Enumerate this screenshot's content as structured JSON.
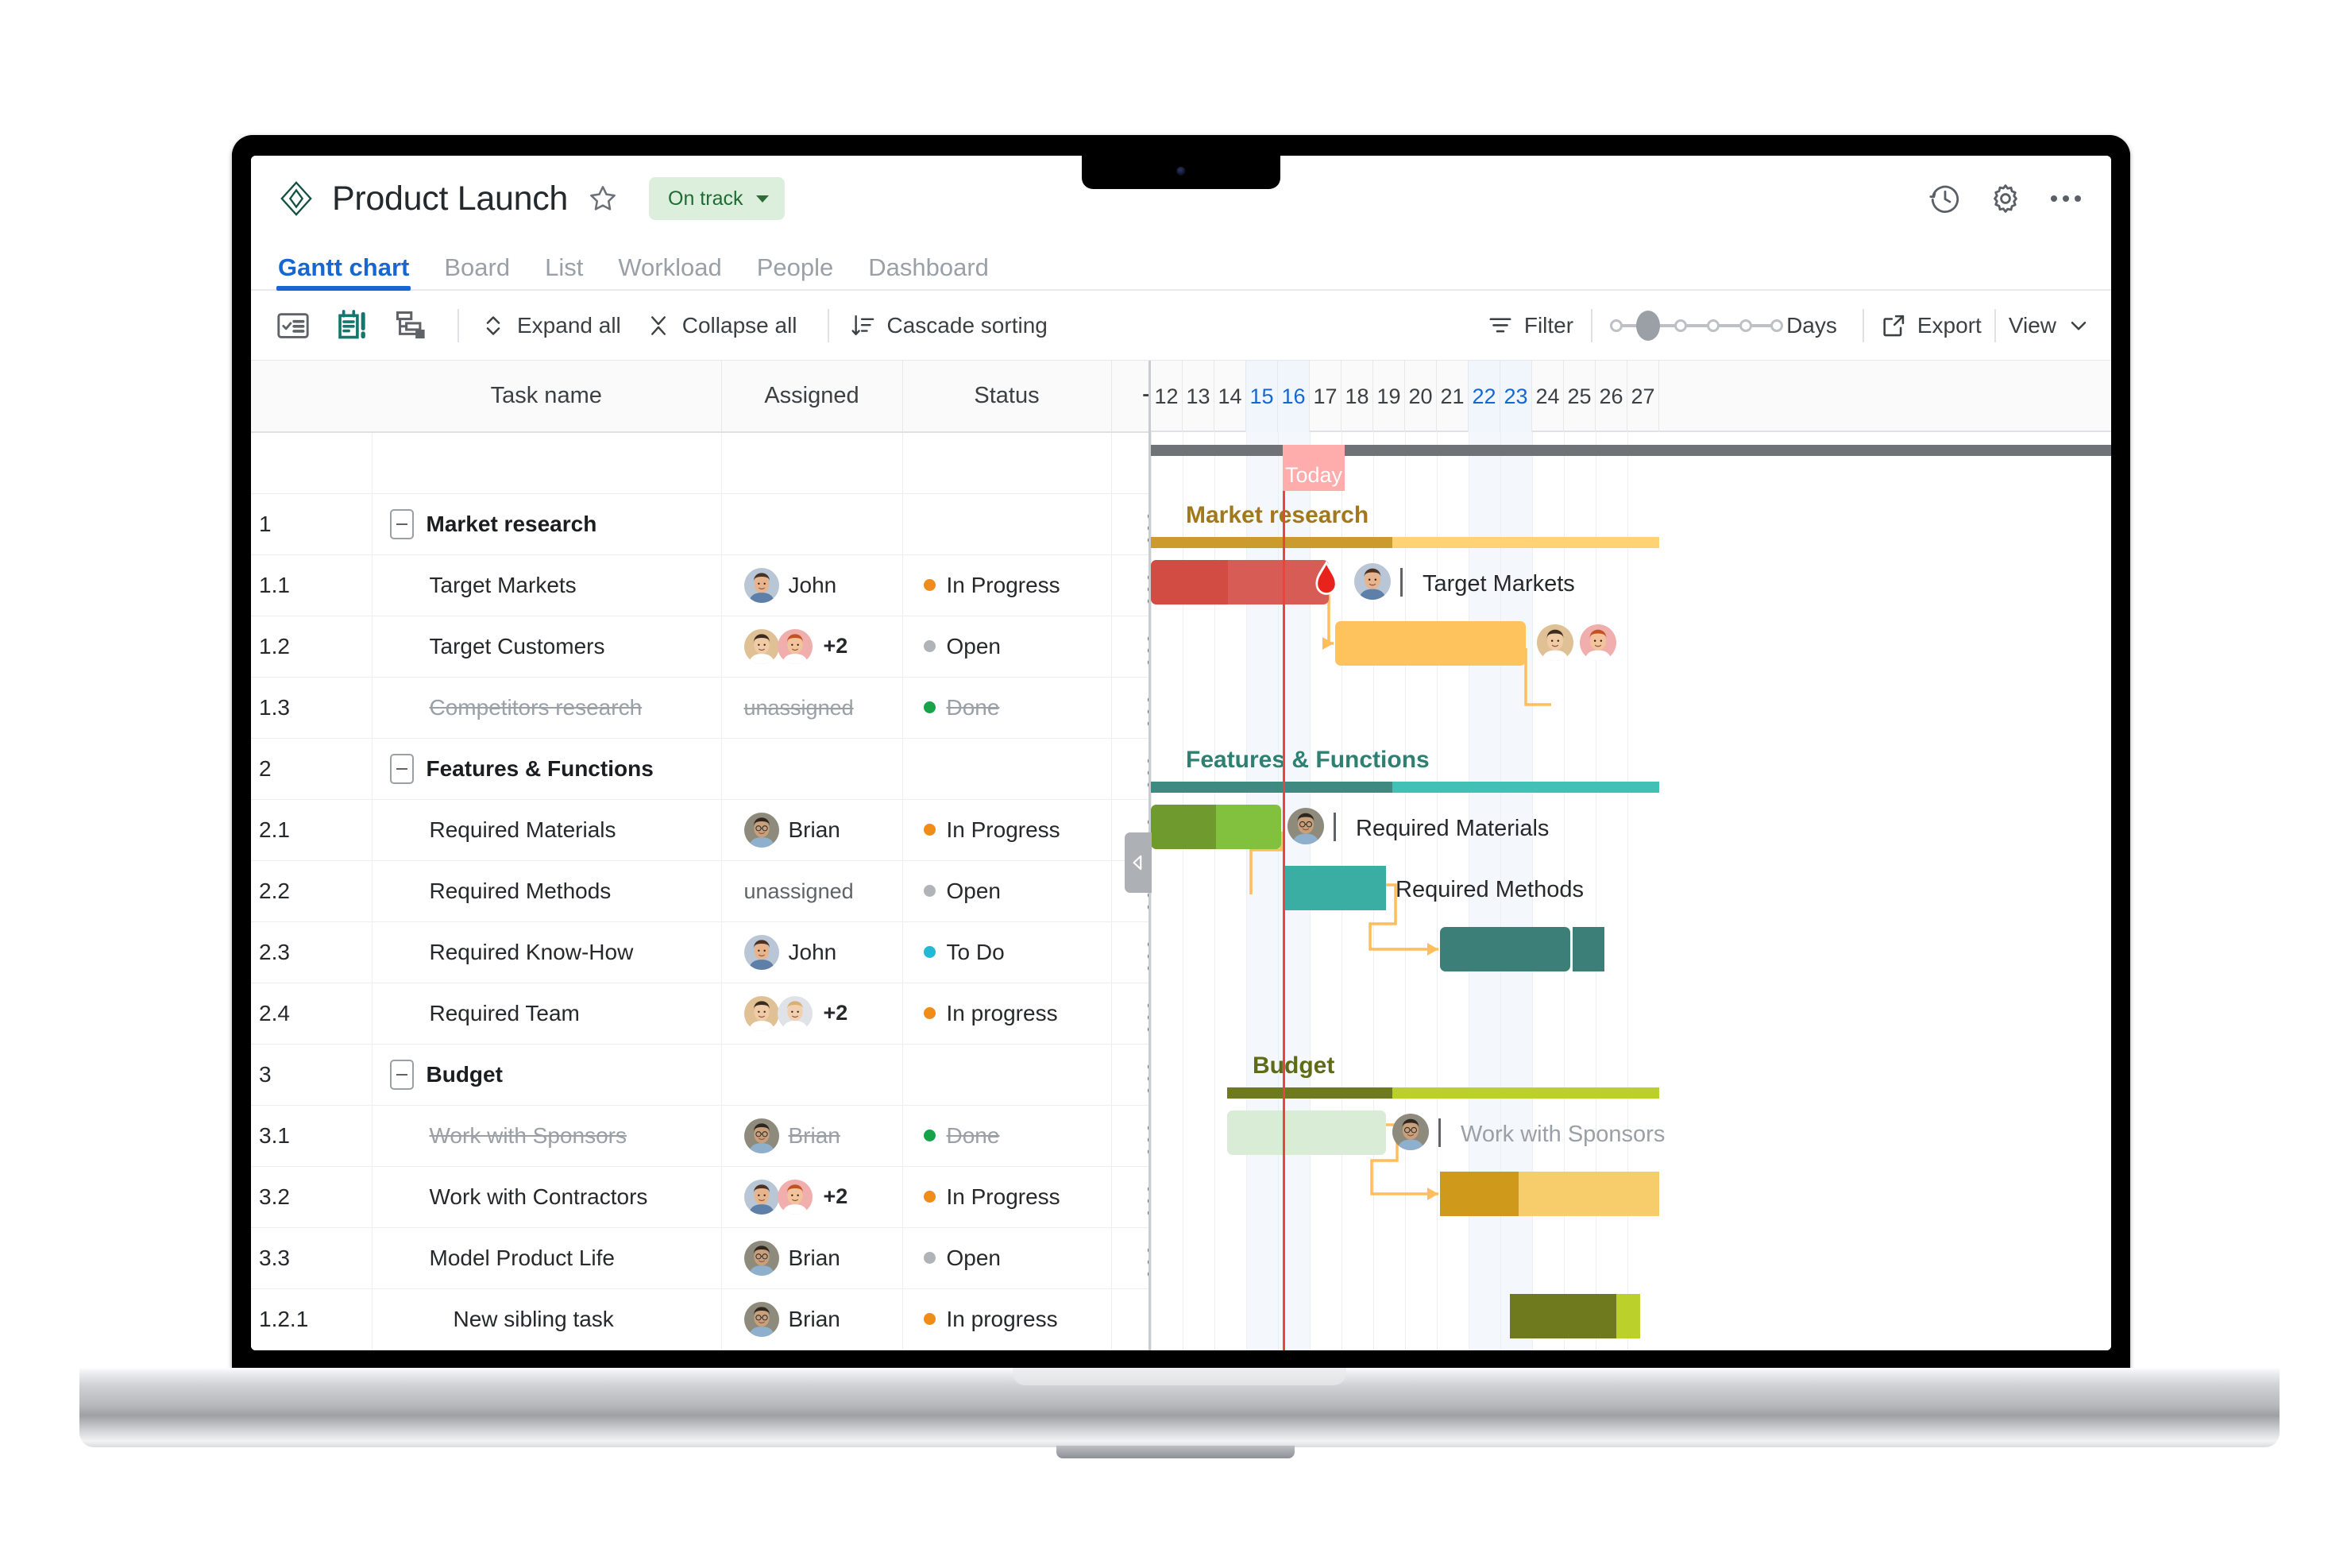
{
  "header": {
    "logo_icon": "diamond-logo-icon",
    "title": "Product Launch",
    "star_icon": "star-outline-icon",
    "status": {
      "label": "On track",
      "color": "#1f6b33",
      "bg": "#dcefdd"
    },
    "actions": [
      {
        "name": "history-icon",
        "label": "History"
      },
      {
        "name": "gear-icon",
        "label": "Settings"
      },
      {
        "name": "more-options-icon",
        "label": "More"
      }
    ]
  },
  "tabs": [
    {
      "label": "Gantt chart",
      "active": true
    },
    {
      "label": "Board",
      "active": false
    },
    {
      "label": "List",
      "active": false
    },
    {
      "label": "Workload",
      "active": false
    },
    {
      "label": "People",
      "active": false
    },
    {
      "label": "Dashboard",
      "active": false
    }
  ],
  "toolbar": {
    "icons": [
      {
        "name": "task-list-icon"
      },
      {
        "name": "critical-path-icon"
      },
      {
        "name": "subtasks-icon"
      }
    ],
    "expand_all": "Expand all",
    "collapse_all": "Collapse all",
    "cascade_sorting": "Cascade sorting",
    "filter": "Filter",
    "zoom_label": "Days",
    "zoom_steps": 6,
    "zoom_active_index": 1,
    "export": "Export",
    "view": "View"
  },
  "grid": {
    "columns": [
      "",
      "Task name",
      "Assigned",
      "Status",
      "+"
    ],
    "add_column_icon": "plus-icon",
    "rows": [
      {
        "no": "",
        "name": "",
        "kind": "blank"
      },
      {
        "no": "1",
        "name": "Market research",
        "kind": "group",
        "level": 1,
        "assigned": "",
        "status": ""
      },
      {
        "no": "1.1",
        "name": "Target Markets",
        "kind": "task",
        "level": 2,
        "assigned": "John",
        "avatars": 1,
        "status": "In Progress",
        "status_color": "#f08c1a"
      },
      {
        "no": "1.2",
        "name": "Target Customers",
        "kind": "task",
        "level": 2,
        "assigned": "",
        "avatars": 2,
        "extra": "+2",
        "status": "Open",
        "status_color": "#b0b4b8"
      },
      {
        "no": "1.3",
        "name": "Competitors research",
        "kind": "task",
        "level": 2,
        "assigned": "unassigned",
        "avatars": 0,
        "status": "Done",
        "status_color": "#16a34a",
        "done": true
      },
      {
        "no": "2",
        "name": "Features & Functions",
        "kind": "group",
        "level": 1,
        "assigned": "",
        "status": ""
      },
      {
        "no": "2.1",
        "name": "Required Materials",
        "kind": "task",
        "level": 2,
        "assigned": "Brian",
        "avatars": 1,
        "status": "In Progress",
        "status_color": "#f08c1a"
      },
      {
        "no": "2.2",
        "name": "Required Methods",
        "kind": "task",
        "level": 2,
        "assigned": "unassigned",
        "avatars": 0,
        "status": "Open",
        "status_color": "#b0b4b8"
      },
      {
        "no": "2.3",
        "name": "Required Know-How",
        "kind": "task",
        "level": 2,
        "assigned": "John",
        "avatars": 1,
        "status": "To Do",
        "status_color": "#22b8d6"
      },
      {
        "no": "2.4",
        "name": "Required Team",
        "kind": "task",
        "level": 2,
        "assigned": "",
        "avatars": 2,
        "extra": "+2",
        "status": "In progress",
        "status_color": "#f08c1a"
      },
      {
        "no": "3",
        "name": "Budget",
        "kind": "group",
        "level": 1,
        "assigned": "",
        "status": ""
      },
      {
        "no": "3.1",
        "name": "Work with Sponsors",
        "kind": "task",
        "level": 2,
        "assigned": "Brian",
        "avatars": 1,
        "status": "Done",
        "status_color": "#16a34a",
        "done": true
      },
      {
        "no": "3.2",
        "name": "Work with Contractors",
        "kind": "task",
        "level": 2,
        "assigned": "",
        "avatars": 2,
        "extra": "+2",
        "status": "In Progress",
        "status_color": "#f08c1a"
      },
      {
        "no": "3.3",
        "name": "Model Product Life",
        "kind": "task",
        "level": 2,
        "assigned": "Brian",
        "avatars": 1,
        "status": "Open",
        "status_color": "#b0b4b8"
      },
      {
        "no": "1.2.1",
        "name": "New sibling task",
        "kind": "task",
        "level": 3,
        "assigned": "Brian",
        "avatars": 1,
        "status": "In progress",
        "status_color": "#f08c1a"
      }
    ]
  },
  "chart_data": {
    "type": "gantt",
    "timescale": "Days",
    "days": [
      {
        "label": "12",
        "weekend": false
      },
      {
        "label": "13",
        "weekend": false
      },
      {
        "label": "14",
        "weekend": false
      },
      {
        "label": "15",
        "weekend": true
      },
      {
        "label": "16",
        "weekend": true
      },
      {
        "label": "17",
        "weekend": false
      },
      {
        "label": "18",
        "weekend": false
      },
      {
        "label": "19",
        "weekend": false
      },
      {
        "label": "20",
        "weekend": false
      },
      {
        "label": "21",
        "weekend": false
      },
      {
        "label": "22",
        "weekend": true
      },
      {
        "label": "23",
        "weekend": true
      },
      {
        "label": "24",
        "weekend": false
      },
      {
        "label": "25",
        "weekend": false
      },
      {
        "label": "26",
        "weekend": false
      },
      {
        "label": "27",
        "weekend": false
      }
    ],
    "today": {
      "label": "Today",
      "day_index": 4.2,
      "color": "#e8453c",
      "flag_bg": "#ffacac"
    },
    "groups": [
      {
        "name": "Market research",
        "color": "#a3781c",
        "bar_color_done": "#cc9b2e",
        "bar_color_rest": "#ffd276",
        "start": 0,
        "end": 16,
        "progress_end": 7.6,
        "label_x": 1.1,
        "row": 1
      },
      {
        "name": "Features & Functions",
        "color": "#2e8073",
        "bar_color_done": "#3e8a81",
        "bar_color_rest": "#41c0b5",
        "start": 0,
        "end": 16,
        "progress_end": 7.6,
        "label_x": 1.1,
        "row": 5
      },
      {
        "name": "Budget",
        "color": "#5f6b17",
        "bar_color_done": "#6f7a1f",
        "bar_color_rest": "#bcd02c",
        "start": 2.4,
        "end": 16,
        "progress_end": 7.6,
        "label_x": 3.2,
        "row": 10
      }
    ],
    "bars": [
      {
        "task": "Target Markets",
        "row": 2,
        "start": 0,
        "end": 5.6,
        "progress": 0.435,
        "color": "#d65c55",
        "color_done": "#d24c44",
        "label": "Target Markets",
        "has_avatar": true,
        "has_flame": true
      },
      {
        "task": "Target Customers",
        "row": 3,
        "start": 5.8,
        "end": 11.8,
        "progress": 0,
        "color": "#ffc35e",
        "color_done": "#ffc35e",
        "label": "",
        "avatars_right": 2
      },
      {
        "task": "Required Materials",
        "row": 6,
        "start": 0,
        "end": 4.1,
        "progress": 0.5,
        "color": "#82c13e",
        "color_done": "#6f9a2e",
        "label": "Required Materials",
        "has_avatar": true
      },
      {
        "task": "Required Methods",
        "row": 7,
        "start": 4.2,
        "end": 7.4,
        "progress": 0,
        "color": "#3aaea2",
        "color_done": "#3aaea2",
        "label": "Required Methods",
        "square": true
      },
      {
        "task": "Required Know-How",
        "row": 8,
        "start": 9.1,
        "end": 14.2,
        "progress": 0,
        "color": "#3c7e78",
        "color_done": "#3c7e78",
        "label": "",
        "split_at": 13.2
      },
      {
        "task": "Work with Sponsors",
        "row": 11,
        "start": 2.4,
        "end": 7.4,
        "progress": 0,
        "color": "#d9ecd6",
        "color_done": "#d9ecd6",
        "label": "Work with Sponsors",
        "has_avatar": true,
        "muted": true
      },
      {
        "task": "Work with Contractors",
        "row": 12,
        "start": 9.1,
        "end": 16,
        "progress": 0.36,
        "color": "#f7cc6a",
        "color_done": "#cf9a1c",
        "label": "",
        "square": true
      },
      {
        "task": "New sibling task",
        "row": 14,
        "start": 11.3,
        "end": 15.4,
        "progress": 0.82,
        "color": "#bcd02c",
        "color_done": "#6f7a1f",
        "label": "",
        "square": true
      }
    ],
    "dependency_links": [
      {
        "from": "Target Markets",
        "to": "Target Customers",
        "color": "#ffbe5c"
      },
      {
        "from": "Target Customers",
        "to": "Competitors research",
        "color": "#ffbe5c"
      },
      {
        "from": "Required Materials",
        "to": "Required Methods",
        "color": "#ffbe5c"
      },
      {
        "from": "Required Methods",
        "to": "Required Know-How",
        "color": "#ffbe5c"
      },
      {
        "from": "Work with Sponsors",
        "to": "Work with Contractors",
        "color": "#ffbe5c"
      }
    ],
    "collapse_handle_icon": "chevron-left-icon"
  }
}
